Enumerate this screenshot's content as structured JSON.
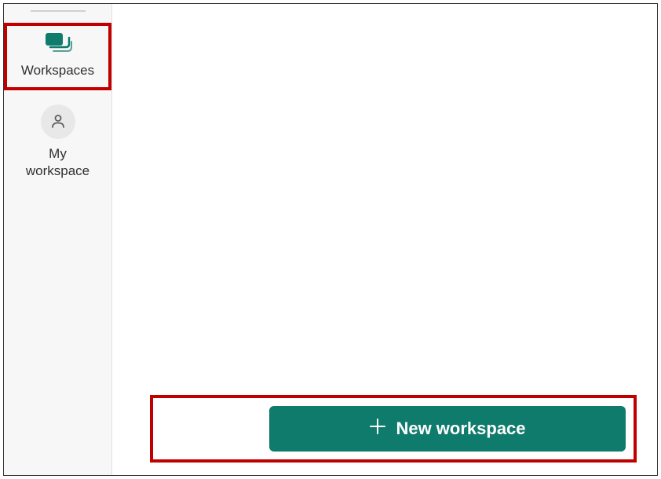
{
  "sidebar": {
    "workspaces": {
      "label": "Workspaces"
    },
    "myWorkspace": {
      "labelLine1": "My",
      "labelLine2": "workspace"
    }
  },
  "main": {
    "newWorkspaceButton": {
      "label": "New workspace"
    }
  },
  "colors": {
    "primary": "#0f7b6c",
    "highlight": "#c00000",
    "sidebarBg": "#f7f7f7"
  }
}
